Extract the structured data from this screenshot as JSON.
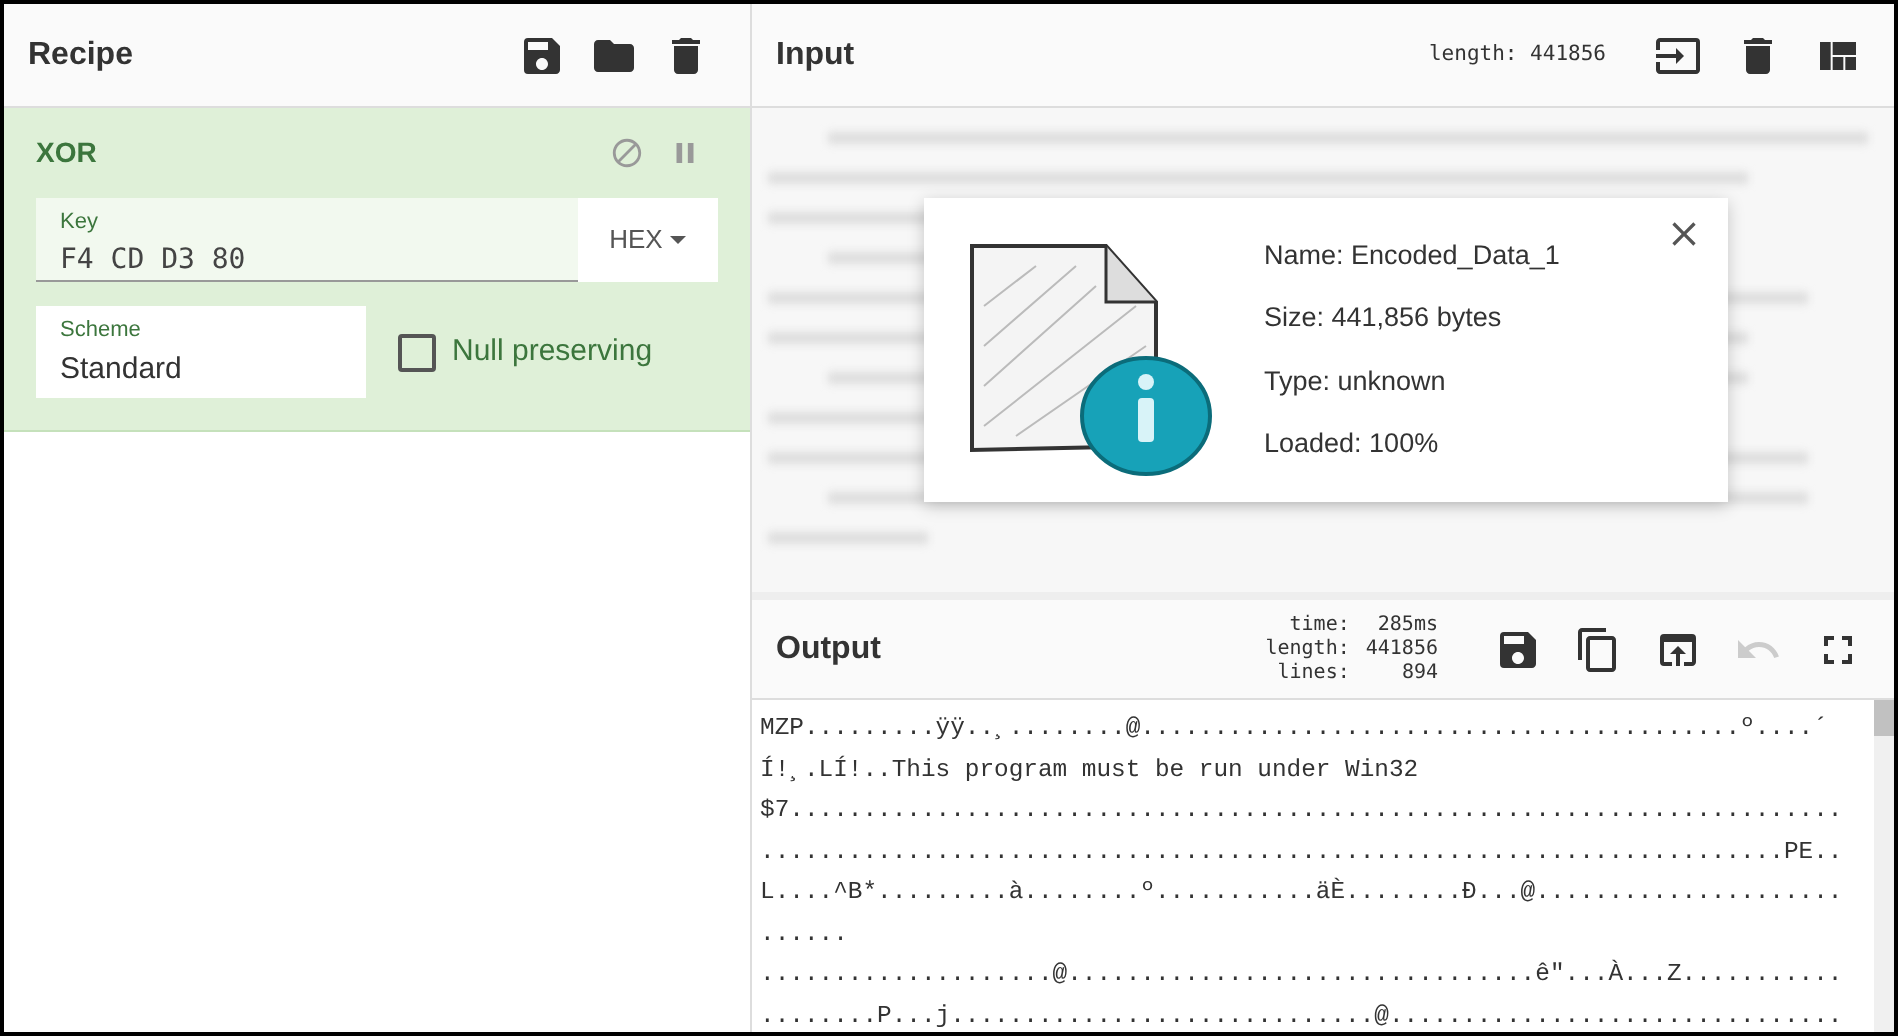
{
  "recipe": {
    "title": "Recipe"
  },
  "operation": {
    "name": "XOR",
    "key": {
      "label": "Key",
      "value": "F4 CD D3 80",
      "format": "HEX"
    },
    "scheme": {
      "label": "Scheme",
      "value": "Standard"
    },
    "null_preserving": {
      "label": "Null preserving",
      "checked": false
    }
  },
  "input": {
    "title": "Input",
    "length": "length: 441856"
  },
  "file_info": {
    "details": [
      "Name: Encoded_Data_1",
      "Size: 441,856 bytes",
      "Type: unknown",
      "Loaded: 100%"
    ]
  },
  "output": {
    "title": "Output",
    "stats": [
      {
        "label": "time:",
        "value": "285ms"
      },
      {
        "label": "length:",
        "value": "441856"
      },
      {
        "label": "lines:",
        "value": "894"
      }
    ],
    "undo_disabled": true,
    "lines": [
      "MZP.........ÿÿ..¸........@.........................................º....´",
      "Í!¸.LÍ!..This program must be run under Win32",
      "$7........................................................................",
      "......................................................................PE..",
      "L....^B*.........à........º...........äÈ........Ð...@.....................",
      "......",
      "....................@................................ê\"...À...Z...........",
      "........P...j.............................@..............................."
    ]
  }
}
